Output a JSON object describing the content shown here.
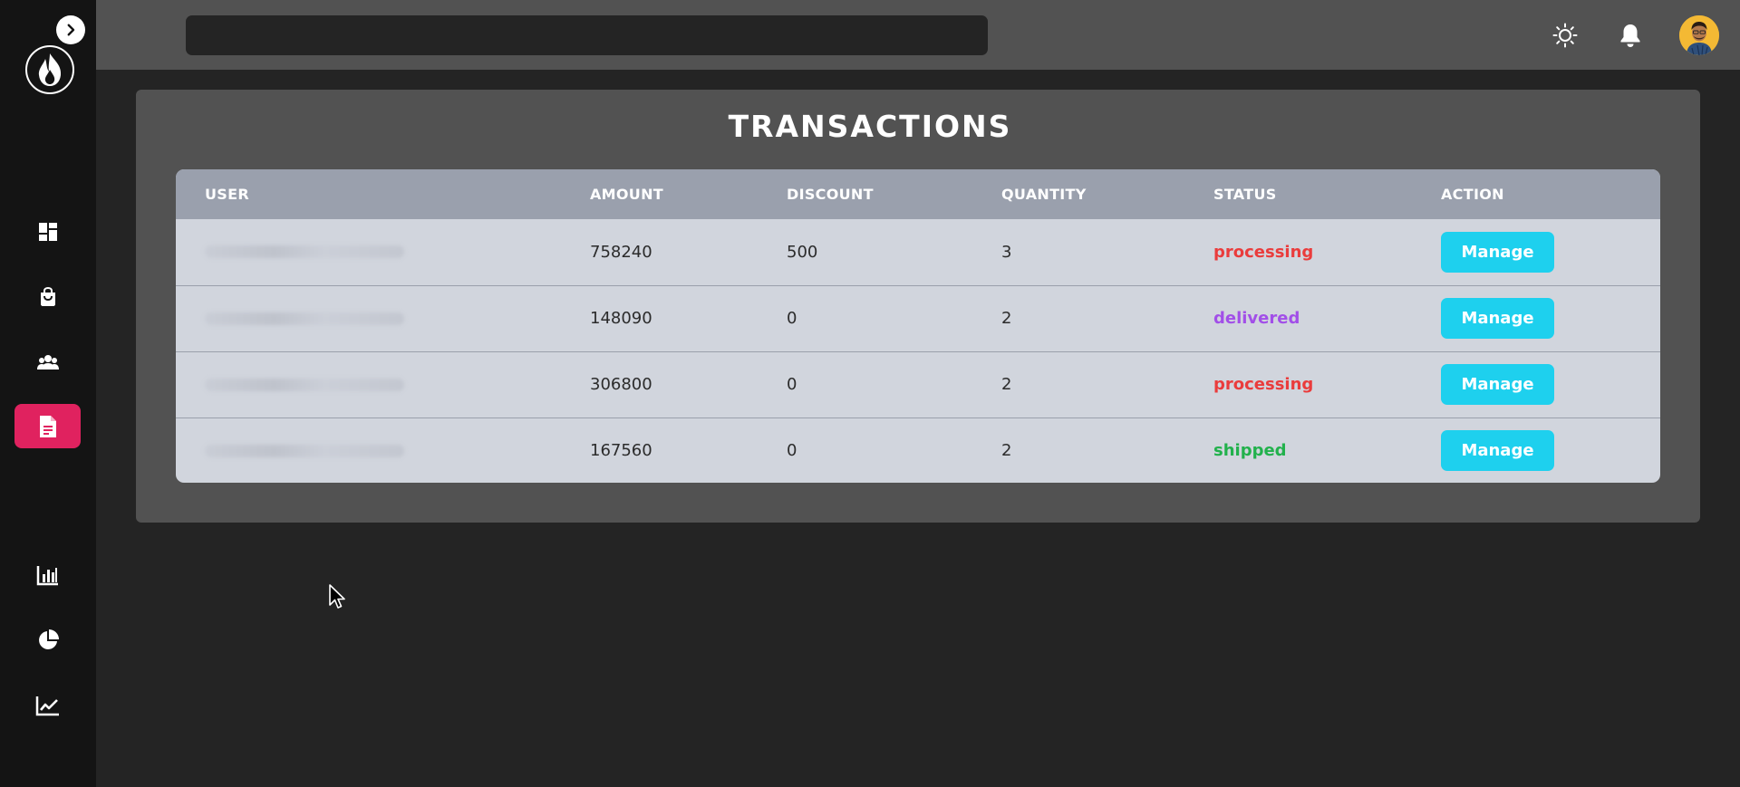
{
  "sidebar": {
    "collapse_icon": "chevron-right-icon",
    "logo_icon": "flame-icon",
    "nav": [
      {
        "key": "dashboard",
        "icon": "dashboard-icon",
        "active": false
      },
      {
        "key": "products",
        "icon": "shopping-bag-icon",
        "active": false
      },
      {
        "key": "customers",
        "icon": "people-icon",
        "active": false
      },
      {
        "key": "transactions",
        "icon": "document-icon",
        "active": true
      },
      {
        "key": "bar-chart",
        "icon": "bar-chart-icon",
        "active": false
      },
      {
        "key": "pie-chart",
        "icon": "pie-chart-icon",
        "active": false
      },
      {
        "key": "line-chart",
        "icon": "line-chart-icon",
        "active": false
      }
    ],
    "active_color": "#e0225f"
  },
  "topbar": {
    "search": {
      "value": "",
      "placeholder": ""
    },
    "theme_icon": "sun-icon",
    "notification_icon": "bell-icon",
    "avatar_icon": "user-avatar"
  },
  "page": {
    "title": "TRANSACTIONS"
  },
  "table": {
    "columns": [
      "USER",
      "AMOUNT",
      "DISCOUNT",
      "QUANTITY",
      "STATUS",
      "ACTION"
    ],
    "rows": [
      {
        "user": "",
        "amount": "758240",
        "discount": "500",
        "quantity": "3",
        "status": "processing",
        "action": "Manage"
      },
      {
        "user": "",
        "amount": "148090",
        "discount": "0",
        "quantity": "2",
        "status": "delivered",
        "action": "Manage"
      },
      {
        "user": "",
        "amount": "306800",
        "discount": "0",
        "quantity": "2",
        "status": "processing",
        "action": "Manage"
      },
      {
        "user": "",
        "amount": "167560",
        "discount": "0",
        "quantity": "2",
        "status": "shipped",
        "action": "Manage"
      }
    ]
  },
  "colors": {
    "processing": "#ea3c3c",
    "delivered": "#a24fe8",
    "shipped": "#22b14c",
    "button": "#1ed0ee"
  }
}
